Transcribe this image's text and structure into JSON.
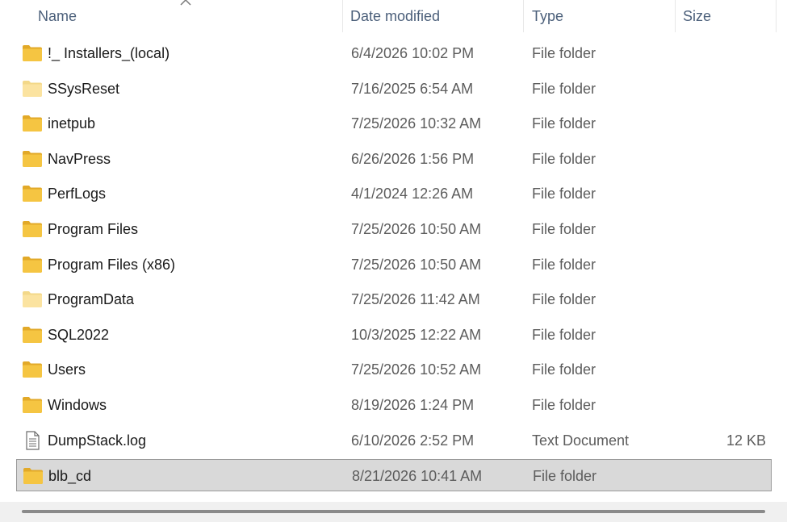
{
  "columns": {
    "name": "Name",
    "date": "Date modified",
    "type": "Type",
    "size": "Size"
  },
  "files": [
    {
      "name": "!_ Installers_(local)",
      "date": "6/4/2026 10:02 PM",
      "type": "File folder",
      "size": "",
      "icon": "folder-icon"
    },
    {
      "name": "SSysReset",
      "date": "7/16/2025 6:54 AM",
      "type": "File folder",
      "size": "",
      "icon": "folder-light-icon"
    },
    {
      "name": "inetpub",
      "date": "7/25/2026 10:32 AM",
      "type": "File folder",
      "size": "",
      "icon": "folder-icon"
    },
    {
      "name": "NavPress",
      "date": "6/26/2026 1:56 PM",
      "type": "File folder",
      "size": "",
      "icon": "folder-icon"
    },
    {
      "name": "PerfLogs",
      "date": "4/1/2024 12:26 AM",
      "type": "File folder",
      "size": "",
      "icon": "folder-icon"
    },
    {
      "name": "Program Files",
      "date": "7/25/2026 10:50 AM",
      "type": "File folder",
      "size": "",
      "icon": "folder-icon"
    },
    {
      "name": "Program Files (x86)",
      "date": "7/25/2026 10:50 AM",
      "type": "File folder",
      "size": "",
      "icon": "folder-icon"
    },
    {
      "name": "ProgramData",
      "date": "7/25/2026 11:42 AM",
      "type": "File folder",
      "size": "",
      "icon": "folder-light-icon"
    },
    {
      "name": "SQL2022",
      "date": "10/3/2025 12:22 AM",
      "type": "File folder",
      "size": "",
      "icon": "folder-icon"
    },
    {
      "name": "Users",
      "date": "7/25/2026 10:52 AM",
      "type": "File folder",
      "size": "",
      "icon": "folder-icon"
    },
    {
      "name": "Windows",
      "date": "8/19/2026 1:24 PM",
      "type": "File folder",
      "size": "",
      "icon": "folder-icon"
    },
    {
      "name": "DumpStack.log",
      "date": "6/10/2026 2:52 PM",
      "type": "Text Document",
      "size": "12 KB",
      "icon": "text-document-icon"
    },
    {
      "name": "blb_cd",
      "date": "8/21/2026 10:41 AM",
      "type": "File folder",
      "size": "",
      "icon": "folder-icon",
      "selected": true
    }
  ],
  "colors": {
    "folder": "#f5c542",
    "folder_light": "#fbe3a0",
    "selection_bg": "#d9d9d9",
    "header_text": "#4b5f7a"
  }
}
